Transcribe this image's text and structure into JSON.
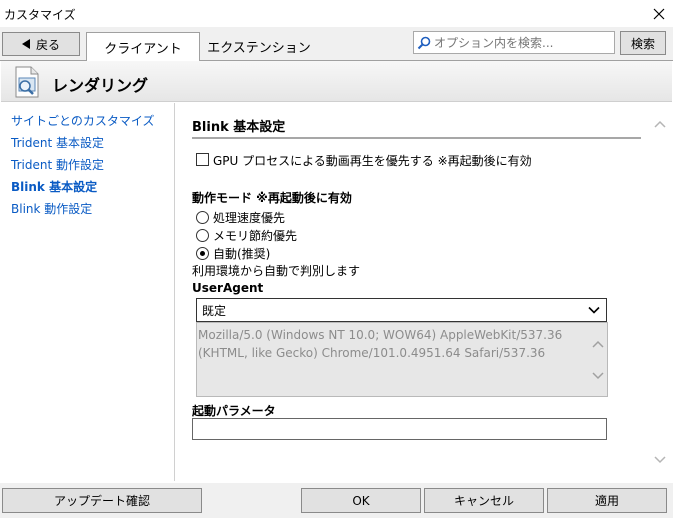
{
  "window": {
    "title": "カスタマイズ"
  },
  "toolbar": {
    "back_label": "戻る",
    "tabs": [
      "クライアント",
      "エクステンション"
    ],
    "search_placeholder": "オプション内を検索...",
    "search_button": "検索"
  },
  "page": {
    "title": "レンダリング"
  },
  "sidebar": {
    "items": [
      {
        "label": "サイトごとのカスタマイズ"
      },
      {
        "label": "Trident 基本設定"
      },
      {
        "label": "Trident 動作設定"
      },
      {
        "label": "Blink 基本設定"
      },
      {
        "label": "Blink 動作設定"
      }
    ]
  },
  "main": {
    "section_title": "Blink 基本設定",
    "gpu_checkbox": {
      "label": "GPU プロセスによる動画再生を優先する ※再起動後に有効",
      "checked": false
    },
    "mode": {
      "label": "動作モード ※再起動後に有効",
      "options": [
        {
          "label": "処理速度優先"
        },
        {
          "label": "メモリ節約優先"
        },
        {
          "label": "自動(推奨)"
        }
      ],
      "selected_index": 2,
      "note": "利用環境から自動で判別します"
    },
    "useragent": {
      "label": "UserAgent",
      "selected": "既定",
      "text_line1": "Mozilla/5.0 (Windows NT 10.0; WOW64) AppleWebKit/537.36",
      "text_line2": "(KHTML, like Gecko) Chrome/101.0.4951.64 Safari/537.36"
    },
    "params": {
      "label": "起動パラメータ",
      "value": ""
    }
  },
  "footer": {
    "update_label": "アップデート確認",
    "ok_label": "OK",
    "cancel_label": "キャンセル",
    "apply_label": "適用"
  },
  "colors": {
    "link": "#0a5bc4",
    "frame_bg": "#f0f0f0"
  },
  "icons": [
    "close-icon",
    "back-arrow-icon",
    "search-icon",
    "rendering-page-icon",
    "chevron-down-icon",
    "scroll-up-icon",
    "scroll-down-icon"
  ]
}
